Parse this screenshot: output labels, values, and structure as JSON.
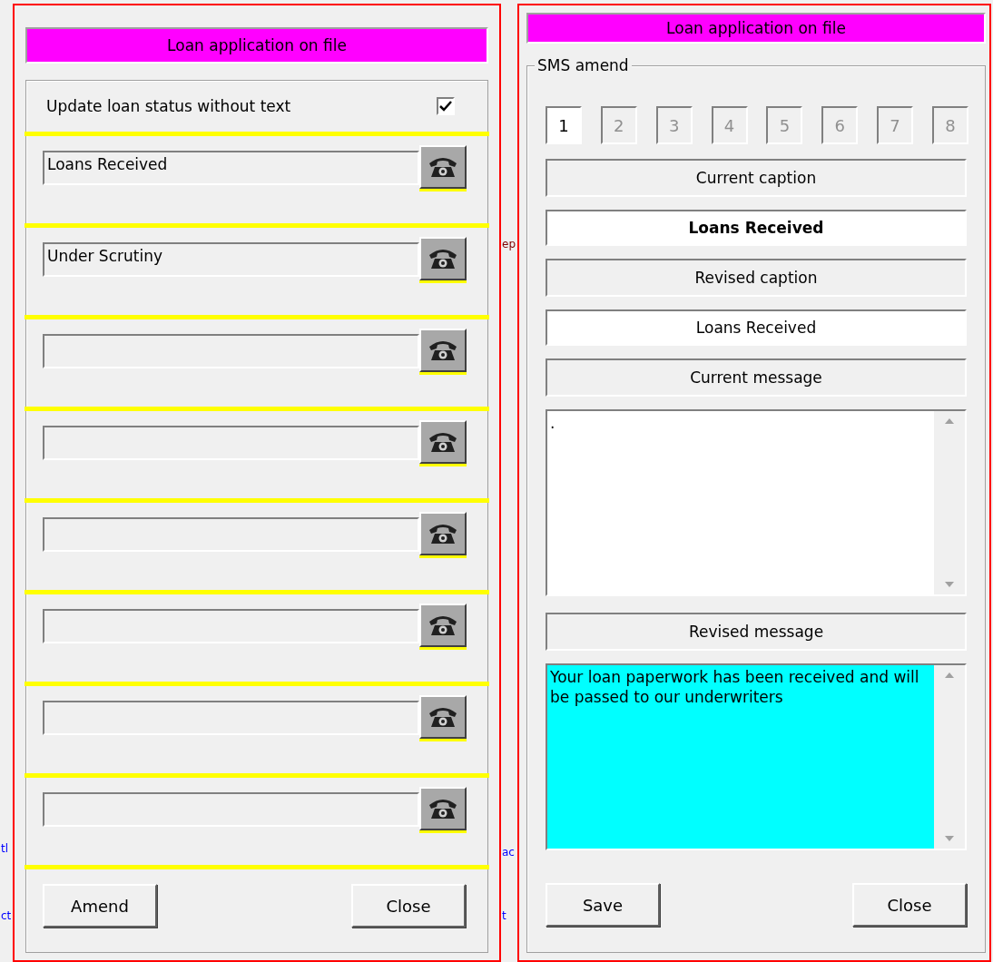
{
  "background_fragments": [
    {
      "text": "tl",
      "color": "#0000ff"
    },
    {
      "text": "ct",
      "color": "#0000ff"
    },
    {
      "text": "ep",
      "color": "#800000"
    },
    {
      "text": "ac",
      "color": "#0000ff"
    },
    {
      "text": "t",
      "color": "#0000ff"
    }
  ],
  "status_panel": {
    "title": "Loan application on file",
    "option": {
      "label": "Update loan status without text",
      "checked": true
    },
    "statuses": [
      {
        "kind": "filled",
        "value": "Loans Received"
      },
      {
        "kind": "filled",
        "value": "Under Scrutiny"
      },
      {
        "kind": "blank"
      },
      {
        "kind": "blank"
      },
      {
        "kind": "blank"
      },
      {
        "kind": "blank"
      },
      {
        "kind": "blank"
      },
      {
        "kind": "blank"
      }
    ],
    "buttons": [
      "Amend",
      "Close"
    ]
  },
  "sms_panel": {
    "title": "Loan application on file",
    "group_label": "SMS amend",
    "slots": [
      {
        "label": "1",
        "selected": true
      },
      {
        "label": "2",
        "selected": false
      },
      {
        "label": "3",
        "selected": false
      },
      {
        "label": "4",
        "selected": false
      },
      {
        "label": "5",
        "selected": false
      },
      {
        "label": "6",
        "selected": false
      },
      {
        "label": "7",
        "selected": false
      },
      {
        "label": "8",
        "selected": false
      }
    ],
    "current_caption_label": "Current caption",
    "current_caption": "Loans Received",
    "revised_caption_label": "Revised caption",
    "revised_caption": "Loans Received",
    "current_message_label": "Current message",
    "current_message": ".",
    "revised_message_label": "Revised message",
    "revised_message": "Your loan paperwork has been received and will be passed to our underwriters",
    "buttons": [
      "Save",
      "Close"
    ]
  }
}
